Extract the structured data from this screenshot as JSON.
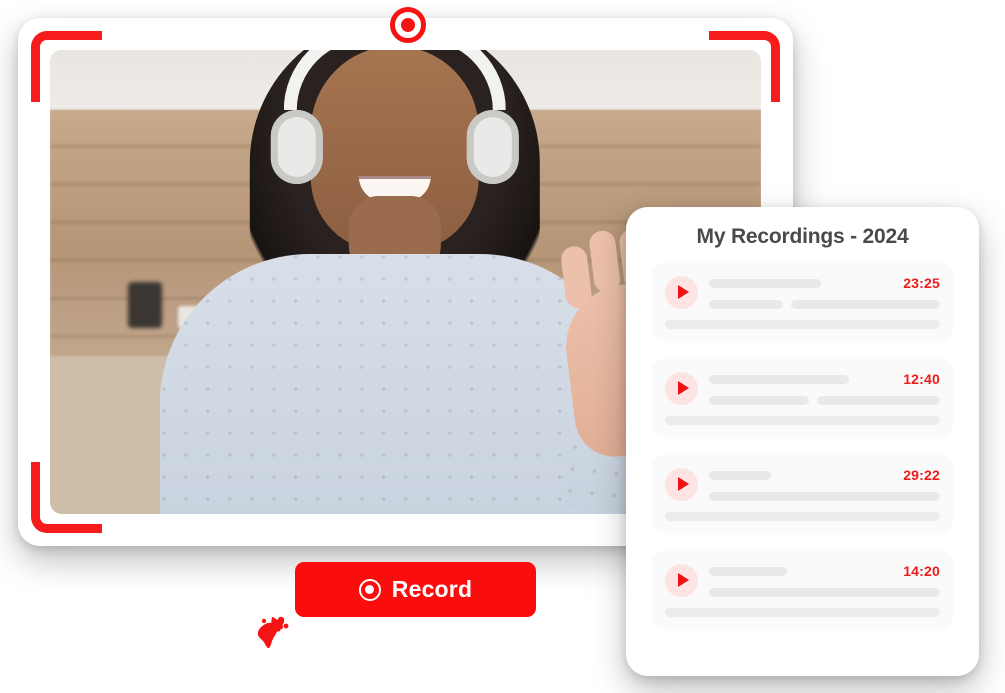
{
  "video_card": {
    "record_indicator_icon": "record-dot-icon",
    "corner_brackets": [
      "top-left",
      "top-right",
      "bottom-left",
      "bottom-right"
    ],
    "scene_alt": "Smiling woman wearing white over-ear headphones and glasses, waving at the camera in a kitchen"
  },
  "record_button": {
    "label": "Record",
    "icon": "record-circle-icon",
    "background_color": "#fb0d0d",
    "text_color": "#ffffff"
  },
  "decor": {
    "splash_icon": "red-splash-icon",
    "color": "#f51414"
  },
  "recordings_panel": {
    "title": "My Recordings - 2024",
    "accent_color": "#ec1c1c",
    "items": [
      {
        "play_icon": "play-icon",
        "duration": "23:25",
        "layout": "two-bars"
      },
      {
        "play_icon": "play-icon",
        "duration": "12:40",
        "layout": "two-bars"
      },
      {
        "play_icon": "play-icon",
        "duration": "29:22",
        "layout": "one-bar"
      },
      {
        "play_icon": "play-icon",
        "duration": "14:20",
        "layout": "one-bar"
      }
    ]
  }
}
